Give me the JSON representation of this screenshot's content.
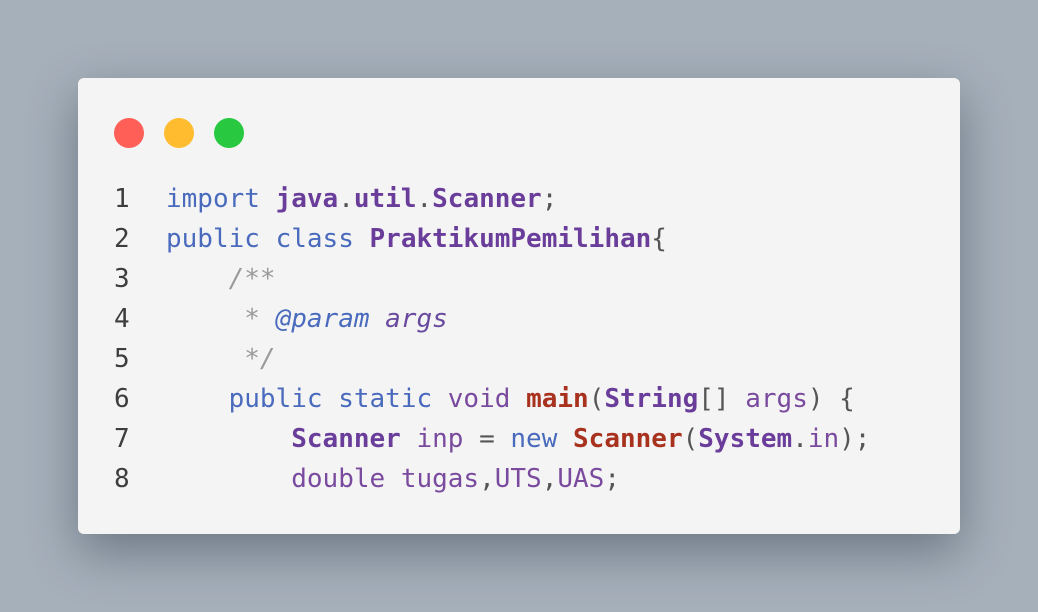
{
  "window": {
    "dots": [
      {
        "name": "close",
        "color": "#ff5f57"
      },
      {
        "name": "minimize",
        "color": "#febc2e"
      },
      {
        "name": "maximize",
        "color": "#28c840"
      }
    ]
  },
  "code": {
    "lines": [
      {
        "num": "1",
        "tokens": [
          {
            "t": "import",
            "c": "kw"
          },
          {
            "t": " ",
            "c": "plain"
          },
          {
            "t": "java",
            "c": "cls"
          },
          {
            "t": ".",
            "c": "plain"
          },
          {
            "t": "util",
            "c": "cls"
          },
          {
            "t": ".",
            "c": "plain"
          },
          {
            "t": "Scanner",
            "c": "cls"
          },
          {
            "t": ";",
            "c": "plain"
          }
        ]
      },
      {
        "num": "2",
        "tokens": [
          {
            "t": "public",
            "c": "kw"
          },
          {
            "t": " ",
            "c": "plain"
          },
          {
            "t": "class",
            "c": "kw"
          },
          {
            "t": " ",
            "c": "plain"
          },
          {
            "t": "PraktikumPemilihan",
            "c": "cls"
          },
          {
            "t": "{",
            "c": "plain"
          }
        ]
      },
      {
        "num": "3",
        "tokens": [
          {
            "t": "    ",
            "c": "plain"
          },
          {
            "t": "/**",
            "c": "cm"
          }
        ]
      },
      {
        "num": "4",
        "tokens": [
          {
            "t": "     ",
            "c": "plain"
          },
          {
            "t": "* ",
            "c": "cm"
          },
          {
            "t": "@param",
            "c": "cm-tag"
          },
          {
            "t": " ",
            "c": "cm"
          },
          {
            "t": "args",
            "c": "cm-arg"
          }
        ]
      },
      {
        "num": "5",
        "tokens": [
          {
            "t": "     ",
            "c": "plain"
          },
          {
            "t": "*/",
            "c": "cm"
          }
        ]
      },
      {
        "num": "6",
        "tokens": [
          {
            "t": "    ",
            "c": "plain"
          },
          {
            "t": "public",
            "c": "kw"
          },
          {
            "t": " ",
            "c": "plain"
          },
          {
            "t": "static",
            "c": "kw"
          },
          {
            "t": " ",
            "c": "plain"
          },
          {
            "t": "void",
            "c": "kw2"
          },
          {
            "t": " ",
            "c": "plain"
          },
          {
            "t": "main",
            "c": "fn"
          },
          {
            "t": "(",
            "c": "plain"
          },
          {
            "t": "String",
            "c": "cls"
          },
          {
            "t": "[] ",
            "c": "plain"
          },
          {
            "t": "args",
            "c": "id"
          },
          {
            "t": ") {",
            "c": "plain"
          }
        ]
      },
      {
        "num": "7",
        "tokens": [
          {
            "t": "        ",
            "c": "plain"
          },
          {
            "t": "Scanner",
            "c": "cls"
          },
          {
            "t": " ",
            "c": "plain"
          },
          {
            "t": "inp",
            "c": "id"
          },
          {
            "t": " = ",
            "c": "plain"
          },
          {
            "t": "new",
            "c": "kw"
          },
          {
            "t": " ",
            "c": "plain"
          },
          {
            "t": "Scanner",
            "c": "fn"
          },
          {
            "t": "(",
            "c": "plain"
          },
          {
            "t": "System",
            "c": "cls"
          },
          {
            "t": ".",
            "c": "plain"
          },
          {
            "t": "in",
            "c": "id"
          },
          {
            "t": ");",
            "c": "plain"
          }
        ]
      },
      {
        "num": "8",
        "tokens": [
          {
            "t": "        ",
            "c": "plain"
          },
          {
            "t": "double",
            "c": "kw2"
          },
          {
            "t": " ",
            "c": "plain"
          },
          {
            "t": "tugas",
            "c": "id"
          },
          {
            "t": ",",
            "c": "plain"
          },
          {
            "t": "UTS",
            "c": "id"
          },
          {
            "t": ",",
            "c": "plain"
          },
          {
            "t": "UAS",
            "c": "id"
          },
          {
            "t": ";",
            "c": "plain"
          }
        ]
      }
    ]
  }
}
